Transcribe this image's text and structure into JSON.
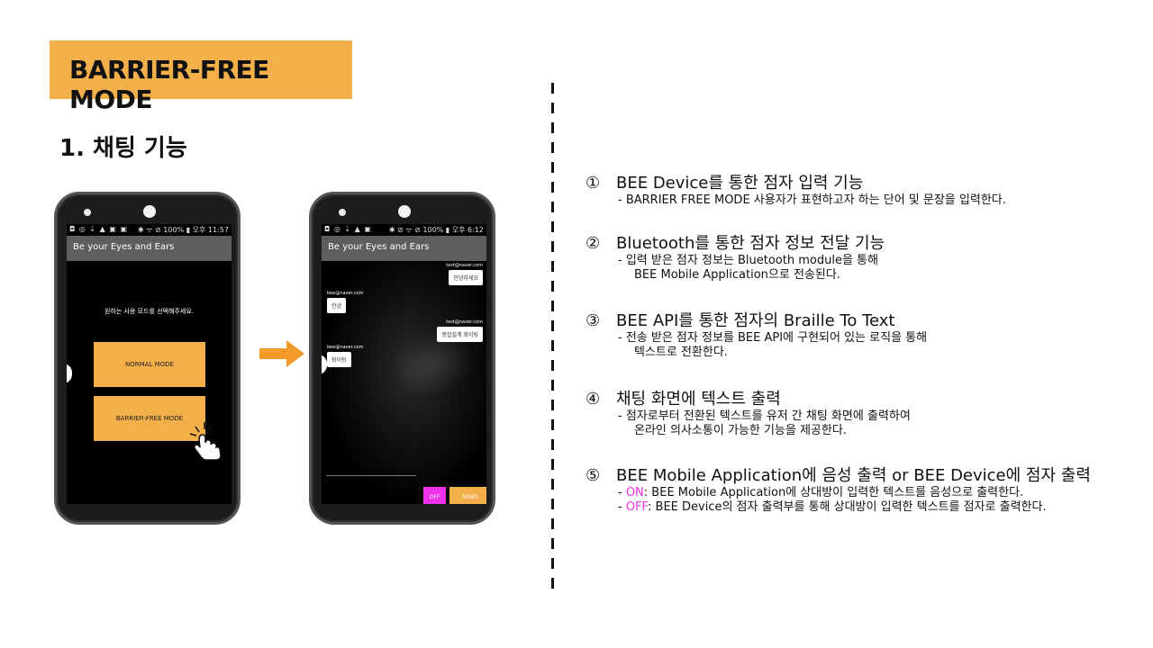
{
  "title": "BARRIER-FREE MODE",
  "section_title": "1. 채팅 기능",
  "phone1": {
    "status_left": "◘ ◎ ⇣ ▲ ▣ ▣",
    "status_right": "✱ ᯤ ⊘ 100% ▮ 오후 11:57",
    "app_title": "Be your Eyes and Ears",
    "prompt": "원하는 사용 모드를 선택해주세요.",
    "normal_mode": "NORMAL MODE",
    "barrier_free_mode": "BARRIER-FREE MODE"
  },
  "phone2": {
    "status_left": "◘ ◎ ⇣ ▲ ▣",
    "status_right": "✱ ⊘ ᯤ ⊘ 100% ▮ 오후 6:12",
    "app_title": "Be your Eyes and Ears",
    "messages": [
      {
        "email": "test@naver.com",
        "text": "안녕하세요",
        "side": "right"
      },
      {
        "email": "bee@naver.com",
        "text": "안녕",
        "side": "left"
      },
      {
        "email": "test@naver.com",
        "text": "종합설계 화이팅",
        "side": "right"
      },
      {
        "email": "bee@naver.com",
        "text": "화이팅",
        "side": "left"
      }
    ],
    "off_label": "OFF",
    "send_label": "SEND"
  },
  "features": [
    {
      "num": "①",
      "head": "BEE Device를 통한 점자 입력 기능",
      "desc": [
        "- BARRIER FREE MODE 사용자가 표현하고자 하는 단어 및 문장을 입력한다."
      ]
    },
    {
      "num": "②",
      "head": "Bluetooth를 통한 점자 정보 전달 기능",
      "desc": [
        "- 입력 받은 점자 정보는 Bluetooth  module을 통해",
        "BEE Mobile  Application으로  전송된다."
      ]
    },
    {
      "num": "③",
      "head": "BEE API를 통한 점자의 Braille To Text",
      "desc": [
        "- 전송 받은 점자 정보를 BEE API에 구현되어 있는 로직을 통해",
        "텍스트로 전환한다."
      ]
    },
    {
      "num": "④",
      "head": "채팅 화면에 텍스트 출력",
      "desc": [
        "- 점자로부터 전환된 텍스트를 유저 간 채팅 화면에 출력하여",
        "온라인 의사소통이 가능한 기능을 제공한다."
      ]
    },
    {
      "num": "⑤",
      "head": "BEE Mobile Application에 음성 출력 or BEE Device에 점자 출력",
      "on_label": "ON",
      "on_desc": ": BEE Mobile Application에  상대방이 입력한 텍스트를 음성으로 출력한다.",
      "off_label": "OFF",
      "off_desc": ": BEE Device의 점자 출력부를 통해 상대방이 입력한 텍스트를 점자로 출력한다."
    }
  ],
  "colors": {
    "accent_orange": "#f3b04a",
    "magenta": "#ef32ea",
    "arrow_orange": "#f39a2a"
  },
  "icons": [
    "hand-pointer-icon",
    "arrow-right-icon"
  ]
}
